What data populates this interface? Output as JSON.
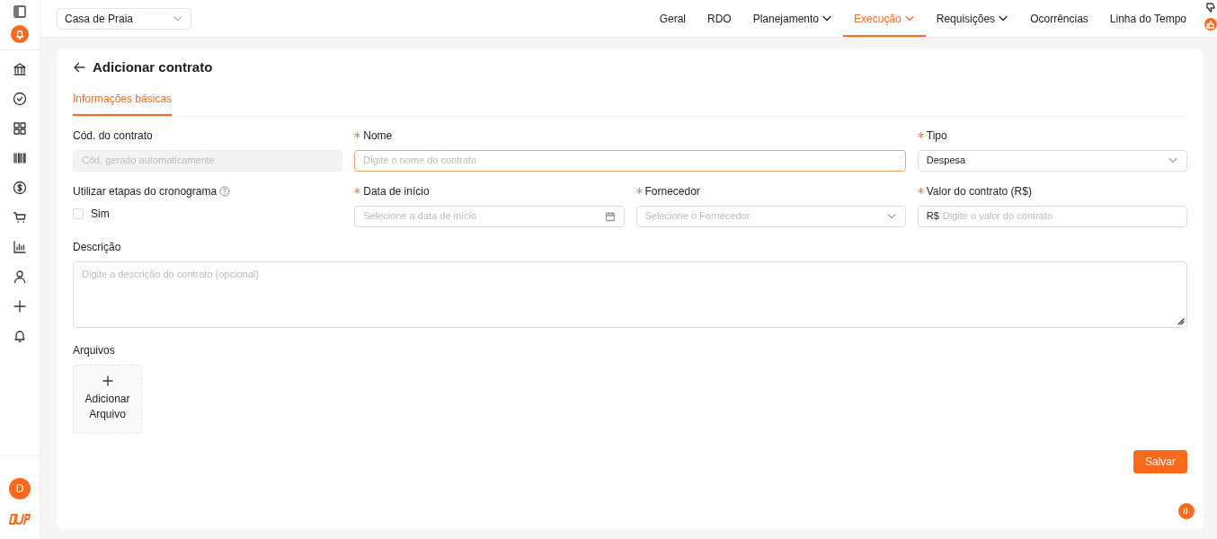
{
  "sidebar": {
    "avatar": "D"
  },
  "project_select": {
    "value": "Casa de Praia"
  },
  "nav": [
    {
      "label": "Geral",
      "selected": false,
      "dropdown": false
    },
    {
      "label": "RDO",
      "selected": false,
      "dropdown": false
    },
    {
      "label": "Planejamento",
      "selected": false,
      "dropdown": true
    },
    {
      "label": "Execução",
      "selected": true,
      "dropdown": true
    },
    {
      "label": "Requisições",
      "selected": false,
      "dropdown": true
    },
    {
      "label": "Ocorrências",
      "selected": false,
      "dropdown": false
    },
    {
      "label": "Linha do Tempo",
      "selected": false,
      "dropdown": false
    }
  ],
  "page": {
    "title": "Adicionar contrato"
  },
  "tabs": [
    {
      "label": "Informações básicas",
      "selected": true
    }
  ],
  "form_rows": [
    [
      {
        "kind": "text",
        "label": "Cód. do contrato",
        "required": false,
        "placeholder": "Cód. gerado automaticamente",
        "disabled": true,
        "focused": false
      },
      {
        "kind": "text",
        "label": "Nome",
        "required": true,
        "placeholder": "Digite o nome do contrato",
        "disabled": false,
        "focused": true
      },
      {
        "kind": "select",
        "label": "Tipo",
        "required": true,
        "value": "Despesa",
        "disabled": false,
        "focused": false
      }
    ],
    [
      {
        "kind": "checkbox",
        "label": "Utilizar etapas do cronograma",
        "help": true,
        "option": "Sim",
        "checked": false
      },
      {
        "kind": "date",
        "label": "Data de início",
        "required": true,
        "placeholder": "Selecione a data de início",
        "disabled": false,
        "focused": false
      },
      {
        "kind": "select",
        "label": "Fornecedor",
        "required": true,
        "placeholder": "Selecione o Fornecedor",
        "disabled": false,
        "focused": false
      },
      {
        "kind": "currency",
        "label": "Valor do contrato (R$)",
        "required": true,
        "prefix": "R$",
        "placeholder": "Digite o valor do contrato",
        "disabled": false,
        "focused": false
      }
    ],
    [
      {
        "kind": "textarea",
        "label": "Descrição",
        "required": false,
        "placeholder": "Digite a descrição do contrato (opcional)",
        "disabled": false,
        "focused": false
      }
    ]
  ],
  "files": {
    "label": "Arquivos",
    "upload": "Adicionar Arquivo"
  },
  "save_button": "Salvar"
}
